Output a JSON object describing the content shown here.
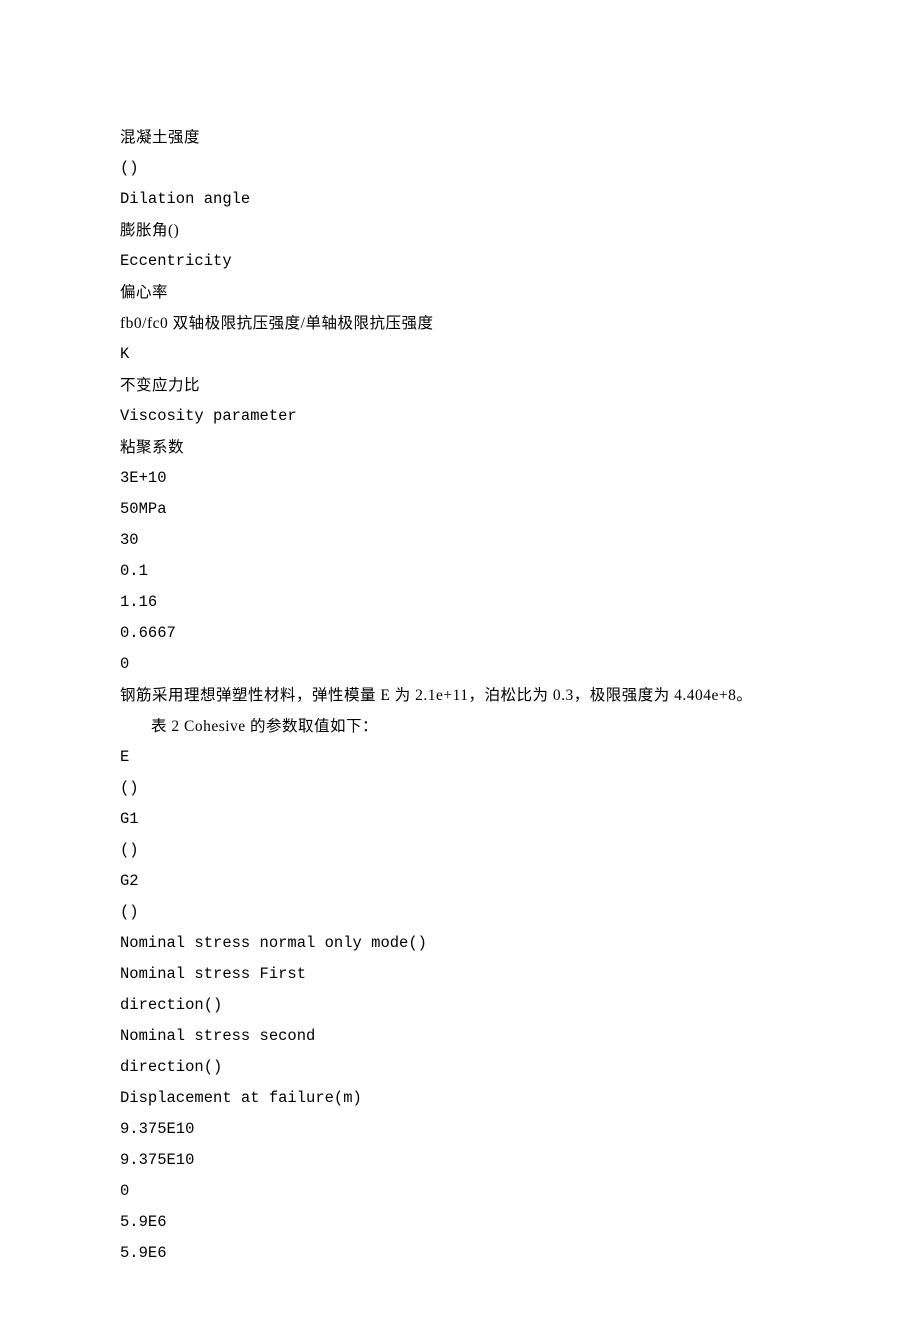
{
  "lines": [
    "混凝土强度",
    "()",
    "Dilation angle",
    "膨胀角()",
    "Eccentricity",
    "偏心率",
    "fb0/fc0 双轴极限抗压强度/单轴极限抗压强度",
    "K",
    "不变应力比",
    "Viscosity parameter",
    "粘聚系数",
    "3E+10",
    "50MPa",
    "30",
    "0.1",
    "1.16",
    "0.6667",
    "0"
  ],
  "steel_text": "钢筋采用理想弹塑性材料，弹性模量 E 为 2.1e+11，泊松比为 0.3，极限强度为 4.404e+8。",
  "table2_caption": "表 2 Cohesive 的参数取值如下：",
  "lines2": [
    "E",
    "()",
    "G1",
    "()",
    "G2",
    "()",
    "Nominal stress normal only mode()",
    "Nominal stress First",
    "direction()",
    "Nominal stress second",
    "direction()",
    "Displacement at failure(m)",
    "9.375E10",
    "9.375E10",
    "0",
    "5.9E6",
    "5.9E6"
  ]
}
